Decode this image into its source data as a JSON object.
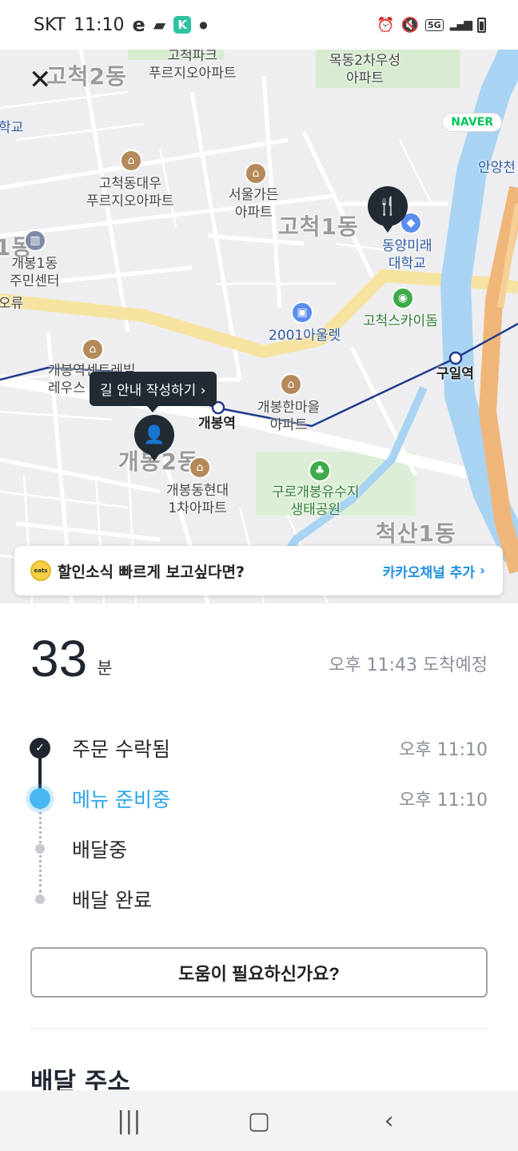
{
  "status_bar": {
    "carrier": "SKT",
    "time": "11:10",
    "network": "5G"
  },
  "map": {
    "district_labels": [
      "고척2동",
      "고척1동",
      "개봉2동",
      "척산1동",
      "1동"
    ],
    "place_labels": {
      "gocheok_park": "고척파크\n푸르지오아파트",
      "mokdong": "목동2차우성\n아파트",
      "gocheok_daewoo": "고척동대우\n푸르지오아파트",
      "seoul_garden": "서울가든\n아파트",
      "dongyang": "동양미래\n대학교",
      "gaebong1": "개봉1동\n주민센터",
      "outlet": "2001아울렛",
      "skydome": "고척스카이돔",
      "guil_station": "구일역",
      "gaebong_central": "개봉역센트레빌\n레우스",
      "gaebong_station": "개봉역",
      "gaebong_hanmaeul": "개봉한마을\n아파트",
      "gaebong_hyundai": "개봉동현대\n1차아파트",
      "guro_park": "구로개봉유수지\n생태공원",
      "school_left": "학교",
      "anyang": "안양천",
      "oryu": "오류",
      "apt_bottom": "아파트"
    },
    "naver_badge": "NAVER",
    "tooltip": "길 안내 작성하기 ›"
  },
  "banner": {
    "logo_text": "eats",
    "text": "할인소식 빠르게 보고싶다면?",
    "action": "카카오채널 추가"
  },
  "eta": {
    "minutes": "33",
    "unit": "분",
    "arrival": "오후 11:43 도착예정"
  },
  "steps": [
    {
      "label": "주문 수락됨",
      "time": "오후 11:10",
      "state": "done"
    },
    {
      "label": "메뉴 준비중",
      "time": "오후 11:10",
      "state": "active"
    },
    {
      "label": "배달중",
      "time": "",
      "state": "pending"
    },
    {
      "label": "배달 완료",
      "time": "",
      "state": "pending"
    }
  ],
  "help_button": "도움이 필요하신가요?",
  "section_title": "배달 주소",
  "colors": {
    "accent": "#49b8f2",
    "dark": "#1f2630",
    "link": "#1d8fe0"
  }
}
